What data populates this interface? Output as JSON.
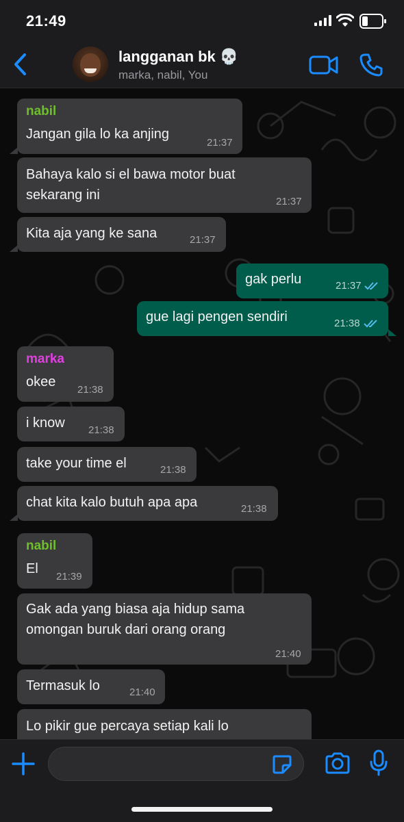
{
  "status_bar": {
    "time": "21:49"
  },
  "header": {
    "title": "langganan bk",
    "title_emoji": "💀",
    "subtitle": "marka, nabil, You"
  },
  "colors": {
    "accent": "#1a8cff",
    "nabil": "#6fbf2c",
    "marka": "#e040e0",
    "outgoing": "#005c4b",
    "incoming": "#3a3a3c"
  },
  "messages": [
    {
      "sender": "nabil",
      "text": "Jangan gila lo ka anjing",
      "time": "21:37",
      "direction": "in"
    },
    {
      "text": "Bahaya kalo si el bawa motor buat\nsekarang ini",
      "time": "21:37",
      "direction": "in"
    },
    {
      "text": "Kita aja yang ke sana",
      "time": "21:37",
      "direction": "in"
    },
    {
      "text": "gak perlu",
      "time": "21:37",
      "direction": "out",
      "status": "read"
    },
    {
      "text": "gue lagi pengen sendiri",
      "time": "21:38",
      "direction": "out",
      "status": "read"
    },
    {
      "sender": "marka",
      "text": "okee",
      "time": "21:38",
      "direction": "in"
    },
    {
      "text": "i know",
      "time": "21:38",
      "direction": "in"
    },
    {
      "text": "take your time el",
      "time": "21:38",
      "direction": "in"
    },
    {
      "text": "chat kita kalo butuh apa apa",
      "time": "21:38",
      "direction": "in"
    },
    {
      "sender": "nabil",
      "text": "El",
      "time": "21:39",
      "direction": "in"
    },
    {
      "text": "Gak ada yang biasa aja hidup sama\nomongan buruk dari orang orang",
      "time": "21:40",
      "direction": "in"
    },
    {
      "text": "Termasuk lo",
      "time": "21:40",
      "direction": "in"
    },
    {
      "text": "Lo pikir gue percaya setiap kali lo",
      "time": "",
      "direction": "in"
    }
  ],
  "composer": {
    "placeholder": ""
  }
}
